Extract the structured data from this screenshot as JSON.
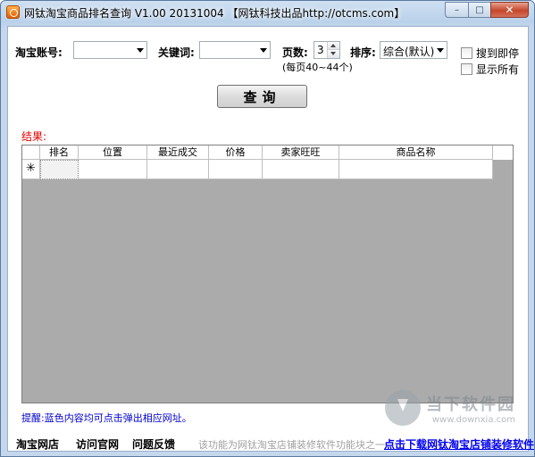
{
  "window": {
    "title": "网钛淘宝商品排名查询 V1.00 20131004 【网钛科技出品http://otcms.com】",
    "minimize": "–",
    "maximize": "□",
    "close": "✕"
  },
  "form": {
    "account_label": "淘宝账号:",
    "account_value": "",
    "keyword_label": "关键词:",
    "keyword_value": "",
    "pages_label": "页数:",
    "pages_value": "3",
    "pages_hint": "(每页40~44个)",
    "sort_label": "排序:",
    "sort_value": "综合(默认)",
    "stop_when_found": "搜到即停",
    "show_all": "显示所有",
    "query_button": "查询"
  },
  "results": {
    "label": "结果:",
    "columns": [
      "排名",
      "位置",
      "最近成交",
      "价格",
      "卖家旺旺",
      "商品名称"
    ],
    "new_row_marker": "✳"
  },
  "footer": {
    "tip": "提醒:蓝色内容均可点击弹出相应网址。",
    "link_taobao": "淘宝网店",
    "link_official": "访问官网",
    "link_feedback": "问题反馈",
    "note": "该功能为网钛淘宝店铺装修软件功能块之一",
    "download_link": "点击下载网钛淘宝店铺装修软件"
  },
  "watermark": {
    "title": "当下软件园",
    "url": "www.downxia.com",
    "icon": "download-arrow-icon"
  }
}
